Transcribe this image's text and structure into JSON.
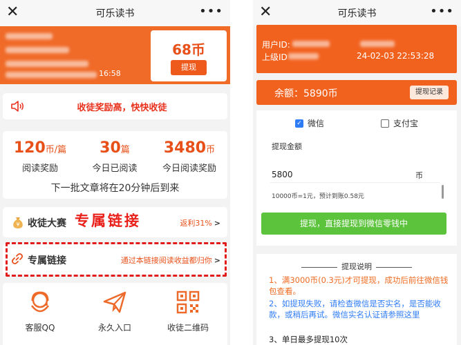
{
  "left": {
    "app_title": "可乐读书",
    "header": {
      "time_fragment": "16:58",
      "coins": "68币",
      "withdraw_label": "提现"
    },
    "notice": "收徒奖励高，快快收徒",
    "stats": [
      {
        "num": "120",
        "unit": "币/篇",
        "label": "阅读奖励"
      },
      {
        "num": "30",
        "unit": "篇",
        "label": "今日已阅读"
      },
      {
        "num": "3480",
        "unit": "币",
        "label": "今日阅读奖励"
      }
    ],
    "next_batch": "下一批文章将在20分钟后到来",
    "contest": {
      "label": "收徒大赛",
      "right": "返利31%",
      "arrow": ">"
    },
    "overlay_text": "专属链接",
    "link_row": {
      "label": "专属链接",
      "right": "通过本链接阅读收益都归你",
      "arrow": ">"
    },
    "bottom": [
      {
        "icon": "headset-icon",
        "label": "客服QQ"
      },
      {
        "icon": "paper-plane-icon",
        "label": "永久入口"
      },
      {
        "icon": "qr-code-icon",
        "label": "收徒二维码"
      }
    ]
  },
  "right": {
    "app_title": "可乐读书",
    "user_id_label": "用户ID:",
    "parent_id_label": "上级ID",
    "datetime": "24-02-03 22:53:28",
    "balance": "余额：5890币",
    "records_label": "提现记录",
    "method_wechat": "微信",
    "method_alipay": "支付宝",
    "amount_label": "提现金额",
    "amount_value": "5800",
    "amount_unit": "币",
    "rate_hint": "10000币=1元，预计到账0.58元",
    "submit_label": "提现，直接提现到微信零钱中",
    "info_title": "提现说明",
    "tips": [
      "1、满3000币(0.3元)才可提现，成功后前往微信钱包查看。",
      "2、如提现失败，请检查微信是否实名，是否能收款，或稍后再试。微信实名认证请参照这里",
      "3、单日最多提现10次"
    ]
  },
  "colors": {
    "orange": "#f06a28",
    "red": "#e21b1b",
    "green": "#5cc33c",
    "blue": "#2f7cf6"
  }
}
